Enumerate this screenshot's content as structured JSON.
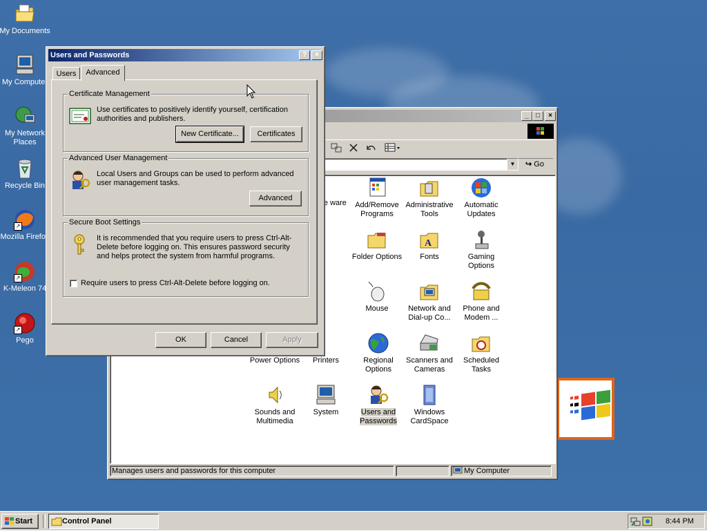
{
  "desktop": {
    "icons": [
      {
        "label": "My Documents"
      },
      {
        "label": "My Computer"
      },
      {
        "label": "My Network Places"
      },
      {
        "label": "Recycle Bin"
      },
      {
        "label": "Mozilla Firefox"
      },
      {
        "label": "K-Meleon 74"
      },
      {
        "label": "Pego"
      }
    ]
  },
  "control_panel": {
    "go_label": "Go",
    "items": [
      {
        "label": "emove ware"
      },
      {
        "label": "Add/Remove Programs"
      },
      {
        "label": "Administrative Tools"
      },
      {
        "label": "Automatic Updates"
      },
      {
        "label": "play"
      },
      {
        "label": "Folder Options"
      },
      {
        "label": "Fonts"
      },
      {
        "label": "Gaming Options"
      },
      {
        "label": "board"
      },
      {
        "label": "Mouse"
      },
      {
        "label": "Network and Dial-up Co..."
      },
      {
        "label": "Phone and Modem ..."
      },
      {
        "label": "Power Options"
      },
      {
        "label": "Printers"
      },
      {
        "label": "Regional Options"
      },
      {
        "label": "Scanners and Cameras"
      },
      {
        "label": "Scheduled Tasks"
      },
      {
        "label": "Sounds and Multimedia"
      },
      {
        "label": "System"
      },
      {
        "label": "Users and Passwords"
      },
      {
        "label": "Windows CardSpace"
      }
    ],
    "status_text": "Manages users and passwords for this computer",
    "status_zone": "My Computer"
  },
  "dialog": {
    "title": "Users and Passwords",
    "help_btn": "?",
    "close_btn": "×",
    "tabs": [
      {
        "label": "Users",
        "active": false
      },
      {
        "label": "Advanced",
        "active": true
      }
    ],
    "cert": {
      "legend": "Certificate Management",
      "text": "Use certificates to positively identify yourself, certification authorities and publishers.",
      "new_btn": "New Certificate...",
      "certs_btn": "Certificates"
    },
    "adv": {
      "legend": "Advanced User Management",
      "text": "Local Users and Groups can be used to perform advanced user management tasks.",
      "btn": "Advanced"
    },
    "boot": {
      "legend": "Secure Boot Settings",
      "text": "It is recommended that you require users to press Ctrl-Alt-Delete before logging on. This ensures password security and helps protect the system from harmful programs.",
      "checkbox_label": "Require users to press Ctrl-Alt-Delete before logging on.",
      "checked": false
    },
    "ok": "OK",
    "cancel": "Cancel",
    "apply": "Apply"
  },
  "taskbar": {
    "start": "Start",
    "task": "Control Panel",
    "clock": "8:44 PM"
  },
  "colors": {
    "desktop": "#3a6ea5",
    "title_active": "#0a246a",
    "title_active_end": "#a6caf0",
    "title_inactive": "#808080",
    "face": "#d4d0c8"
  }
}
